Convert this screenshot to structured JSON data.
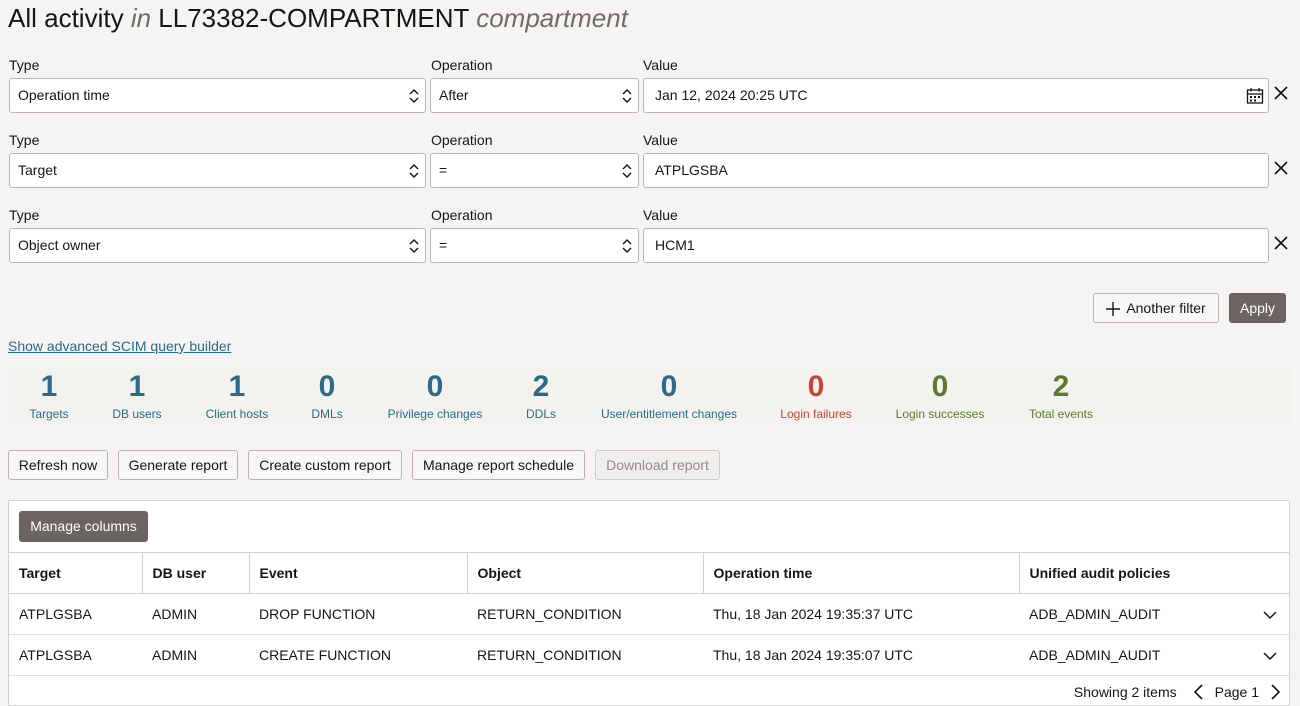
{
  "page": {
    "title_main": "All activity",
    "title_in": "in",
    "title_compartment_name": "LL73382-COMPARTMENT",
    "title_compartment_word": "compartment"
  },
  "filters": [
    {
      "type_label": "Type",
      "type_value": "Operation time",
      "op_label": "Operation",
      "op_value": "After",
      "value_label": "Value",
      "value": "Jan 12, 2024 20:25 UTC"
    },
    {
      "type_label": "Type",
      "type_value": "Target",
      "op_label": "Operation",
      "op_value": "=",
      "value_label": "Value",
      "value": "ATPLGSBA"
    },
    {
      "type_label": "Type",
      "type_value": "Object owner",
      "op_label": "Operation",
      "op_value": "=",
      "value_label": "Value",
      "value": "HCM1"
    }
  ],
  "actions": {
    "another_filter": "Another filter",
    "apply": "Apply",
    "scim_link": "Show advanced SCIM query builder"
  },
  "stats": [
    {
      "value": "1",
      "label": "Targets",
      "color": "#2a6a8a"
    },
    {
      "value": "1",
      "label": "DB users",
      "color": "#2a6a8a"
    },
    {
      "value": "1",
      "label": "Client hosts",
      "color": "#2a6a8a"
    },
    {
      "value": "0",
      "label": "DMLs",
      "color": "#2a6a8a"
    },
    {
      "value": "0",
      "label": "Privilege changes",
      "color": "#2a6a8a"
    },
    {
      "value": "2",
      "label": "DDLs",
      "color": "#2a6a8a"
    },
    {
      "value": "0",
      "label": "User/entitlement changes",
      "color": "#2a6a8a"
    },
    {
      "value": "0",
      "label": "Login failures",
      "color": "#c74634"
    },
    {
      "value": "0",
      "label": "Login successes",
      "color": "#5b7a2e"
    },
    {
      "value": "2",
      "label": "Total events",
      "color": "#5b7a2e"
    }
  ],
  "toolbar": {
    "refresh": "Refresh now",
    "generate": "Generate report",
    "custom": "Create custom report",
    "schedule": "Manage report schedule",
    "download": "Download report"
  },
  "table": {
    "manage_columns": "Manage columns",
    "columns": [
      "Target",
      "DB user",
      "Event",
      "Object",
      "Operation time",
      "Unified audit policies"
    ],
    "rows": [
      [
        "ATPLGSBA",
        "ADMIN",
        "DROP FUNCTION",
        "RETURN_CONDITION",
        "Thu, 18 Jan 2024 19:35:37 UTC",
        "ADB_ADMIN_AUDIT"
      ],
      [
        "ATPLGSBA",
        "ADMIN",
        "CREATE FUNCTION",
        "RETURN_CONDITION",
        "Thu, 18 Jan 2024 19:35:07 UTC",
        "ADB_ADMIN_AUDIT"
      ]
    ],
    "showing": "Showing 2 items",
    "page_label": "Page 1"
  }
}
